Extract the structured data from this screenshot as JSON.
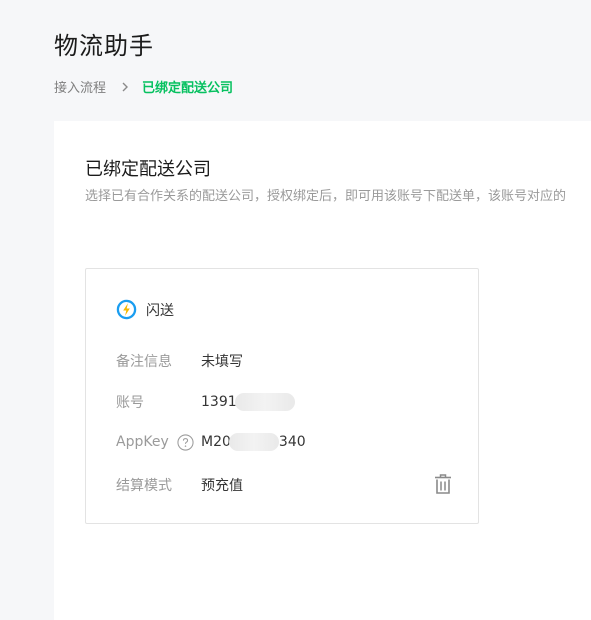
{
  "header": {
    "title": "物流助手"
  },
  "breadcrumb": {
    "parent": "接入流程",
    "current": "已绑定配送公司"
  },
  "section": {
    "title": "已绑定配送公司",
    "description": "选择已有合作关系的配送公司，授权绑定后，即可用该账号下配送单，该账号对应的"
  },
  "card": {
    "brand_icon": "lightning-icon",
    "brand_name": "闪送",
    "rows": [
      {
        "label": "备注信息",
        "value": "未填写"
      },
      {
        "label": "账号",
        "value_prefix": "1391",
        "value_suffix": ""
      },
      {
        "label": "AppKey",
        "value_prefix": "M20",
        "value_suffix": "340"
      },
      {
        "label": "结算模式",
        "value": "预充值"
      }
    ],
    "delete_icon": "trash-icon"
  },
  "colors": {
    "accent": "#07c160",
    "brand_ring": "#1a9df0",
    "brand_bolt": "#f5b800"
  }
}
